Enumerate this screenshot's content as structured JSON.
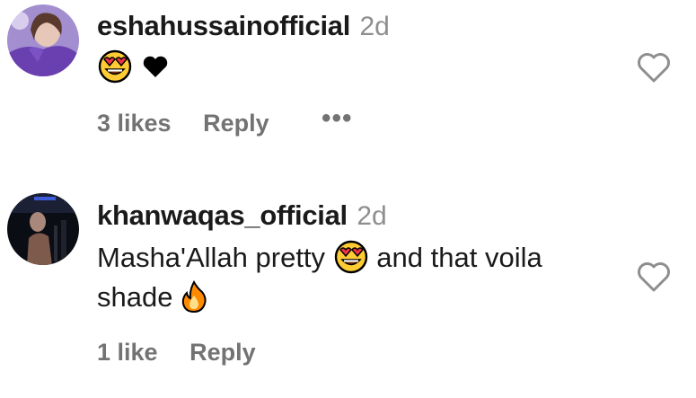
{
  "comments": [
    {
      "username": "eshahussainofficial",
      "time": "2d",
      "text": "",
      "emojis": [
        "heart-eyes-emoji",
        "black-heart-emoji"
      ],
      "likes": "3 likes",
      "reply": "Reply",
      "more": "•••"
    },
    {
      "username": "khanwaqas_official",
      "time": "2d",
      "text_part1": "Masha'Allah pretty",
      "text_part2": "and that voila",
      "text_part3": "shade",
      "emojis": [
        "heart-eyes-emoji",
        "fire-emoji"
      ],
      "likes": "1 like",
      "reply": "Reply"
    }
  ],
  "icons": {
    "like": "heart-outline-icon"
  },
  "colors": {
    "username": "#1a1a1a",
    "meta": "#8e8e8e",
    "action": "#737373"
  }
}
